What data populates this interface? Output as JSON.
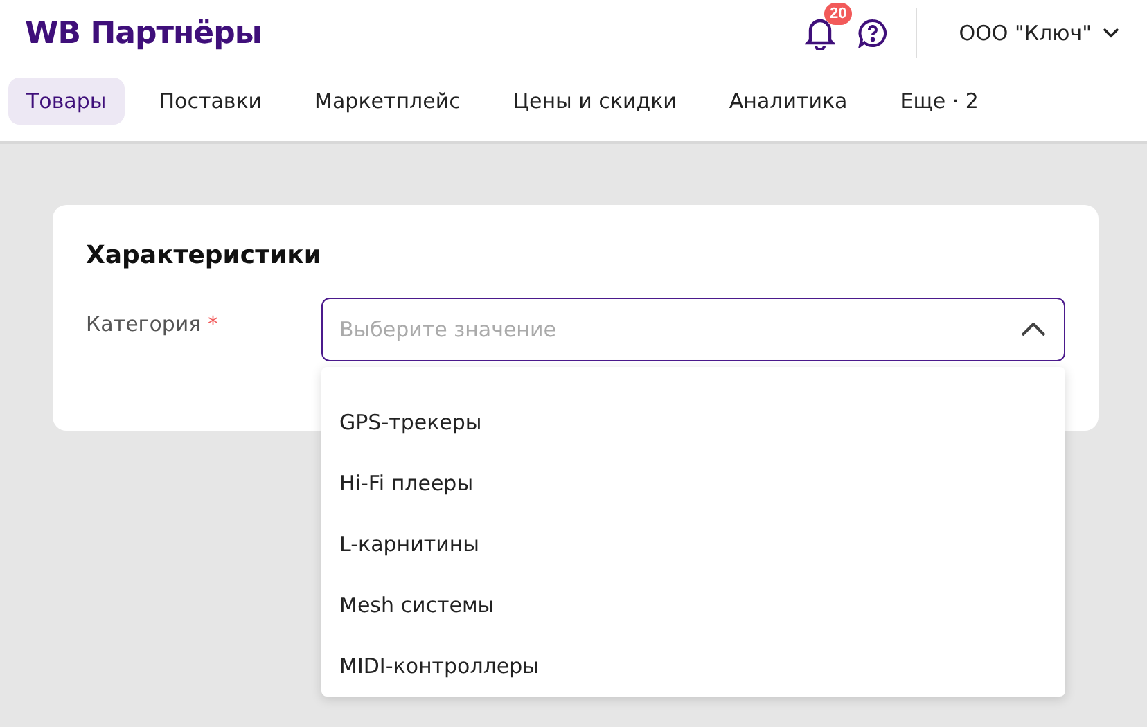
{
  "header": {
    "logo": "WB Партнёры",
    "notifications_badge": "20",
    "account": "ООО \"Ключ\""
  },
  "tabs": [
    {
      "label": "Товары",
      "selected": true
    },
    {
      "label": "Поставки",
      "selected": false
    },
    {
      "label": "Маркетплейс",
      "selected": false
    },
    {
      "label": "Цены и скидки",
      "selected": false
    },
    {
      "label": "Аналитика",
      "selected": false
    },
    {
      "label": "Еще · 2",
      "selected": false
    }
  ],
  "card": {
    "title": "Характеристики",
    "field_label": "Категория",
    "required_mark": "*",
    "placeholder": "Выберите значение",
    "expanded": true,
    "options": [
      "GPS-трекеры",
      "Hi-Fi плееры",
      "L-карнитины",
      "Mesh системы",
      "MIDI-контроллеры"
    ]
  }
}
